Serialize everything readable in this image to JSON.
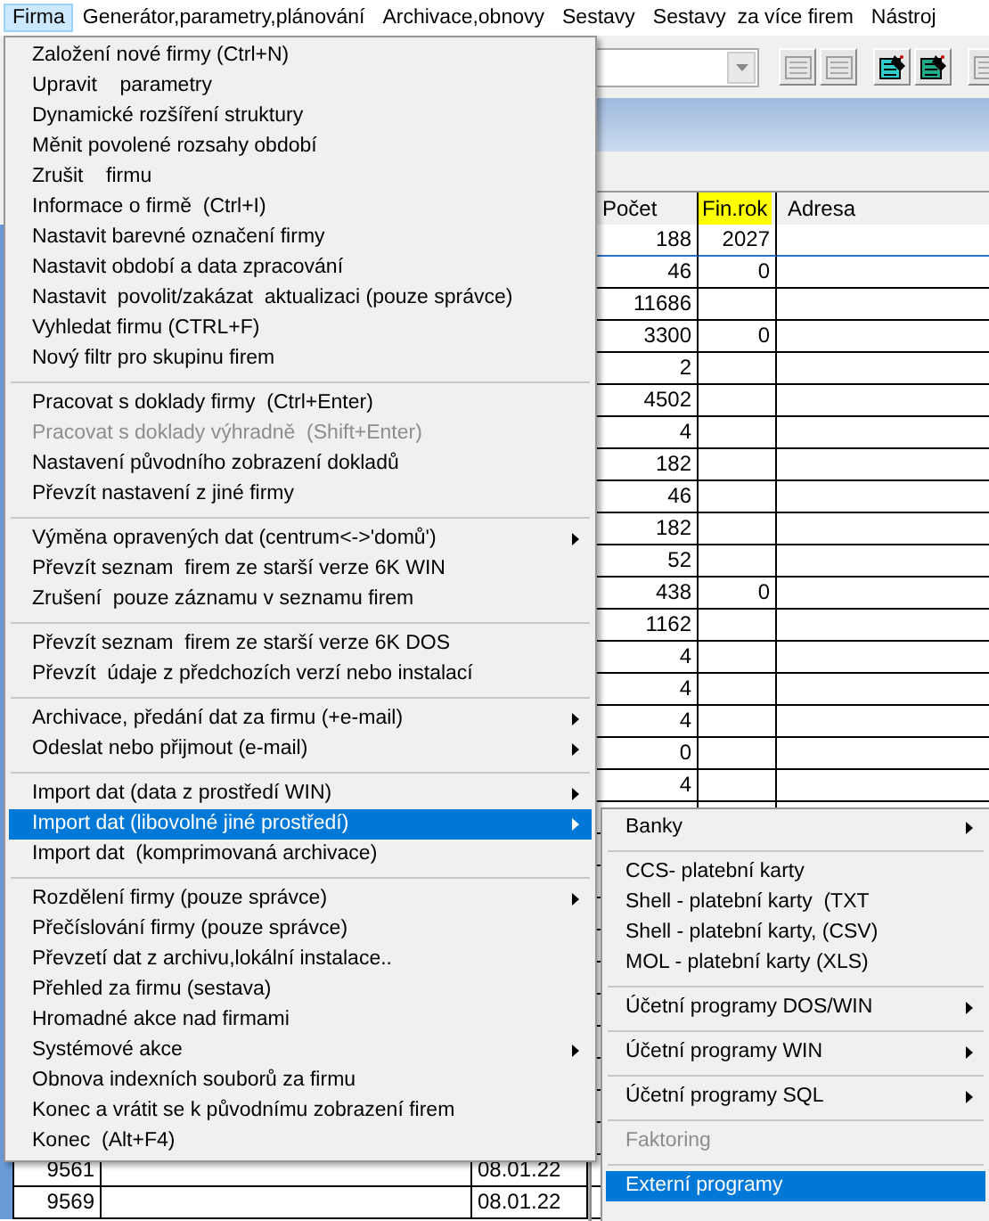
{
  "menubar": [
    {
      "label": "Firma",
      "selected": true
    },
    {
      "label": "Generátor,parametry,plánování",
      "selected": false
    },
    {
      "label": "Archivace,obnovy",
      "selected": false
    },
    {
      "label": "Sestavy",
      "selected": false
    },
    {
      "label": "Sestavy  za více firem",
      "selected": false
    },
    {
      "label": "Nástroj",
      "selected": false
    }
  ],
  "toolbar_buttons": [
    {
      "disabled": true
    },
    {
      "disabled": true
    },
    {
      "disabled": false
    },
    {
      "disabled": false
    },
    {
      "disabled": true
    }
  ],
  "table": {
    "columns": [
      {
        "label": "Počet",
        "highlighted": false
      },
      {
        "label": "Fin.rok",
        "highlighted": true
      },
      {
        "label": "Adresa",
        "highlighted": false
      }
    ],
    "rows": [
      {
        "pocet": "188",
        "fin_rok": "2027",
        "selected": true
      },
      {
        "pocet": "46",
        "fin_rok": "0",
        "selected": false
      },
      {
        "pocet": "11686",
        "selected": false
      },
      {
        "pocet": "3300",
        "fin_rok": "0",
        "selected": false
      },
      {
        "pocet": "2",
        "selected": false
      },
      {
        "pocet": "4502",
        "selected": false
      },
      {
        "pocet": "4",
        "selected": false
      },
      {
        "pocet": "182",
        "selected": false
      },
      {
        "pocet": "46",
        "selected": false
      },
      {
        "pocet": "182",
        "selected": false
      },
      {
        "pocet": "52",
        "selected": false
      },
      {
        "pocet": "438",
        "fin_rok": "0",
        "selected": false
      },
      {
        "pocet": "1162",
        "selected": false
      },
      {
        "pocet": "4",
        "selected": false
      },
      {
        "pocet": "4",
        "selected": false
      },
      {
        "pocet": "4",
        "selected": false
      },
      {
        "pocet": "0",
        "selected": false
      },
      {
        "pocet": "4",
        "selected": false
      }
    ],
    "bottom_rows": [
      {
        "number": "9561",
        "date": "08.01.22"
      },
      {
        "number": "9569",
        "date": "08.01.22"
      }
    ]
  },
  "menu": {
    "groups": [
      [
        {
          "label": "Založení nové firmy (Ctrl+N)",
          "submenu": false,
          "disabled": false,
          "selected": false
        },
        {
          "label": "Upravit    parametry",
          "submenu": false,
          "disabled": false,
          "selected": false
        },
        {
          "label": "Dynamické rozšíření struktury",
          "submenu": false,
          "disabled": false,
          "selected": false
        },
        {
          "label": "Měnit povolené rozsahy období",
          "submenu": false,
          "disabled": false,
          "selected": false
        },
        {
          "label": "Zrušit    firmu",
          "submenu": false,
          "disabled": false,
          "selected": false
        },
        {
          "label": "Informace o firmě  (Ctrl+I)",
          "submenu": false,
          "disabled": false,
          "selected": false
        },
        {
          "label": "Nastavit barevné označení firmy",
          "submenu": false,
          "disabled": false,
          "selected": false
        },
        {
          "label": "Nastavit období a data zpracování",
          "submenu": false,
          "disabled": false,
          "selected": false
        },
        {
          "label": "Nastavit  povolit/zakázat  aktualizaci (pouze správce)",
          "submenu": false,
          "disabled": false,
          "selected": false
        },
        {
          "label": "Vyhledat firmu (CTRL+F)",
          "submenu": false,
          "disabled": false,
          "selected": false
        },
        {
          "label": "Nový filtr pro skupinu firem",
          "submenu": false,
          "disabled": false,
          "selected": false
        }
      ],
      [
        {
          "label": "Pracovat s doklady firmy  (Ctrl+Enter)",
          "submenu": false,
          "disabled": false,
          "selected": false
        },
        {
          "label": "Pracovat s doklady výhradně  (Shift+Enter)",
          "submenu": false,
          "disabled": true,
          "selected": false
        },
        {
          "label": "Nastavení původního zobrazení dokladů",
          "submenu": false,
          "disabled": false,
          "selected": false
        },
        {
          "label": "Převzít nastavení z jiné firmy",
          "submenu": false,
          "disabled": false,
          "selected": false
        }
      ],
      [
        {
          "label": "Výměna opravených dat (centrum<->'domů')",
          "submenu": true,
          "disabled": false,
          "selected": false
        },
        {
          "label": "Převzít seznam  firem ze starší verze 6K WIN",
          "submenu": false,
          "disabled": false,
          "selected": false
        },
        {
          "label": "Zrušení  pouze záznamu v seznamu firem",
          "submenu": false,
          "disabled": false,
          "selected": false
        }
      ],
      [
        {
          "label": "Převzít seznam  firem ze starší verze 6K DOS",
          "submenu": false,
          "disabled": false,
          "selected": false
        },
        {
          "label": "Převzít  údaje z předchozích verzí nebo instalací",
          "submenu": false,
          "disabled": false,
          "selected": false
        }
      ],
      [
        {
          "label": "Archivace, předání dat za firmu (+e-mail)",
          "submenu": true,
          "disabled": false,
          "selected": false
        },
        {
          "label": "Odeslat nebo přijmout (e-mail)",
          "submenu": true,
          "disabled": false,
          "selected": false
        }
      ],
      [
        {
          "label": "Import dat (data z prostředí WIN)",
          "submenu": true,
          "disabled": false,
          "selected": false
        },
        {
          "label": "Import dat (libovolné jiné prostředí)",
          "submenu": true,
          "disabled": false,
          "selected": true
        },
        {
          "label": "Import dat  (komprimovaná archivace)",
          "submenu": false,
          "disabled": false,
          "selected": false
        }
      ],
      [
        {
          "label": "Rozdělení firmy (pouze správce)",
          "submenu": true,
          "disabled": false,
          "selected": false
        },
        {
          "label": "Přečíslování firmy (pouze správce)",
          "submenu": false,
          "disabled": false,
          "selected": false
        },
        {
          "label": "Převzetí dat z archivu,lokální instalace..",
          "submenu": false,
          "disabled": false,
          "selected": false
        },
        {
          "label": "Přehled za firmu (sestava)",
          "submenu": false,
          "disabled": false,
          "selected": false
        },
        {
          "label": "Hromadné akce nad firmami",
          "submenu": false,
          "disabled": false,
          "selected": false
        },
        {
          "label": "Systémové akce",
          "submenu": true,
          "disabled": false,
          "selected": false
        },
        {
          "label": "Obnova indexních souborů za firmu",
          "submenu": false,
          "disabled": false,
          "selected": false
        },
        {
          "label": "Konec a vrátit se k původnímu zobrazení firem",
          "submenu": false,
          "disabled": false,
          "selected": false
        },
        {
          "label": "Konec  (Alt+F4)",
          "submenu": false,
          "disabled": false,
          "selected": false
        }
      ]
    ]
  },
  "submenu": {
    "groups": [
      [
        {
          "label": "Banky",
          "submenu": true,
          "disabled": false,
          "selected": false
        }
      ],
      [
        {
          "label": "CCS- platební karty",
          "submenu": false,
          "disabled": false,
          "selected": false
        },
        {
          "label": "Shell - platební karty  (TXT",
          "submenu": false,
          "disabled": false,
          "selected": false
        },
        {
          "label": "Shell - platební karty, (CSV)",
          "submenu": false,
          "disabled": false,
          "selected": false
        },
        {
          "label": "MOL - platební karty (XLS)",
          "submenu": false,
          "disabled": false,
          "selected": false
        }
      ],
      [
        {
          "label": "Účetní programy DOS/WIN",
          "submenu": true,
          "disabled": false,
          "selected": false
        }
      ],
      [
        {
          "label": "Účetní programy WIN",
          "submenu": true,
          "disabled": false,
          "selected": false
        }
      ],
      [
        {
          "label": "Účetní programy SQL",
          "submenu": true,
          "disabled": false,
          "selected": false
        }
      ],
      [
        {
          "label": "Faktoring",
          "submenu": false,
          "disabled": true,
          "selected": false
        }
      ],
      [
        {
          "label": "Externí programy",
          "submenu": false,
          "disabled": false,
          "selected": true
        }
      ]
    ]
  }
}
